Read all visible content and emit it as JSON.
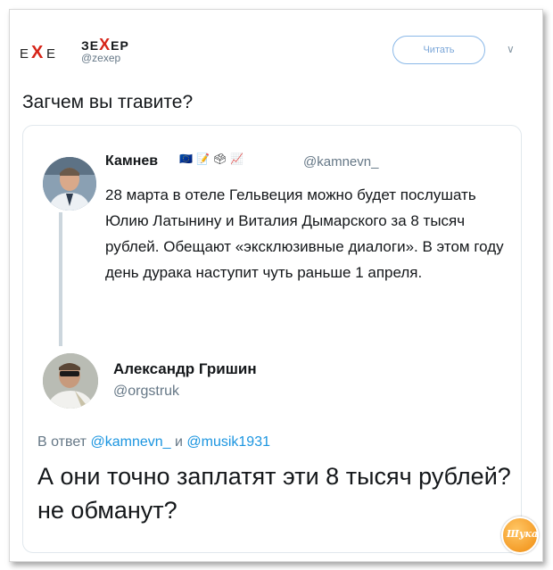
{
  "tweet": {
    "logo": {
      "left": "E",
      "x": "X",
      "right": "E"
    },
    "author": {
      "name_before": "ЗЕ",
      "name_x": "Х",
      "name_after": "ЕР",
      "handle": "@zexep"
    },
    "follow_label": "Читать",
    "text": "Загчем вы тгавите?"
  },
  "quoted": {
    "name": "Камнев",
    "badges": [
      "🇪🇺",
      "📝",
      "🗳",
      "📈"
    ],
    "handle": "@kamnevn_",
    "body": "28 марта в отеле Гельвеция можно будет послушать Юлию Латынину и Виталия Дымарского за 8 тысяч рублей. Обещают «эксклюзивные диалоги». В этом году день дурака наступит чуть раньше 1 апреля."
  },
  "reply": {
    "name": "Александр Гришин",
    "handle": "@orgstruk",
    "reply_prefix": "В ответ",
    "reply_user1": "@kamnevn_",
    "reply_joiner": "и",
    "reply_user2": "@musik1931",
    "body": "А они точно заплатят эти 8 тысяч рублей? не обманут?"
  },
  "watermark": "Шука",
  "colors": {
    "accent": "#1b95e0",
    "brand_x": "#d62418",
    "muted": "#657786"
  }
}
